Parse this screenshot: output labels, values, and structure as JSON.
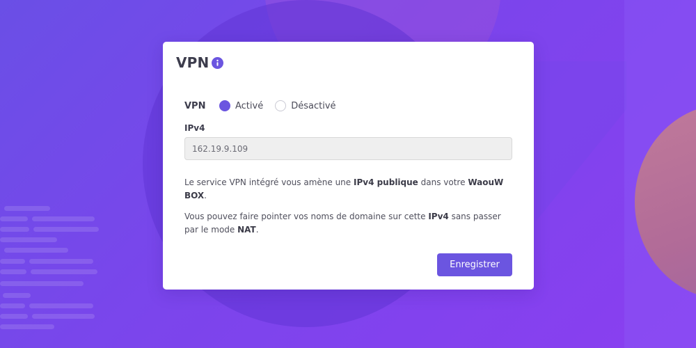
{
  "colors": {
    "accent": "#6b55e0",
    "background_gradient": [
      "#6a4fe6",
      "#8a3ff0"
    ],
    "card_background": "#ffffff",
    "text_primary": "#3c3c4c",
    "input_background": "#efefef"
  },
  "card": {
    "title": "VPN",
    "title_icon": "info-icon"
  },
  "vpn_toggle": {
    "label": "VPN",
    "options": [
      {
        "label": "Activé",
        "checked": true
      },
      {
        "label": "Désactivé",
        "checked": false
      }
    ]
  },
  "ipv4": {
    "label": "IPv4",
    "value": "162.19.9.109"
  },
  "description": {
    "p1": {
      "t1": "Le service VPN intégré vous amène une ",
      "b1": "IPv4 publique",
      "t2": " dans votre ",
      "b2": "WaouW BOX",
      "t3": "."
    },
    "p2": {
      "t1": "Vous pouvez faire pointer vos noms de domaine sur cette ",
      "b1": "IPv4",
      "t2": " sans passer par le mode ",
      "b2": "NAT",
      "t3": "."
    }
  },
  "actions": {
    "save_label": "Enregistrer"
  }
}
